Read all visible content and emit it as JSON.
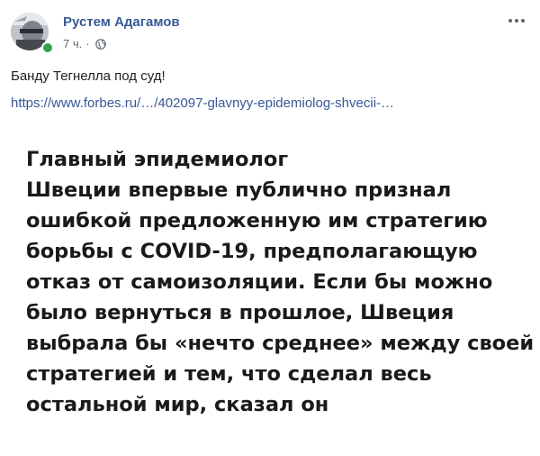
{
  "post": {
    "author": "Рустем Адагамов",
    "time": "7 ч.",
    "separator": "·",
    "privacy_icon": "globe-icon",
    "more_icon": "more-options-icon",
    "text": "Банду Тегнелла под суд!",
    "link": "https://www.forbes.ru/…/402097-glavnyy-epidemiolog-shvecii-…"
  },
  "image": {
    "lines": [
      "Главный эпидемиолог",
      "Швеции впервые публично признал",
      "ошибкой предложенную им стратегию",
      "борьбы с COVID-19, предполагающую",
      "отказ от самоизоляции. Если бы можно",
      "было вернуться в прошлое, Швеция",
      "выбрала бы «нечто среднее» между своей",
      "стратегией и тем, что сделал весь",
      "остальной мир, сказал он"
    ]
  },
  "colors": {
    "link": "#385898",
    "online": "#31a24c",
    "meta": "#606770"
  }
}
